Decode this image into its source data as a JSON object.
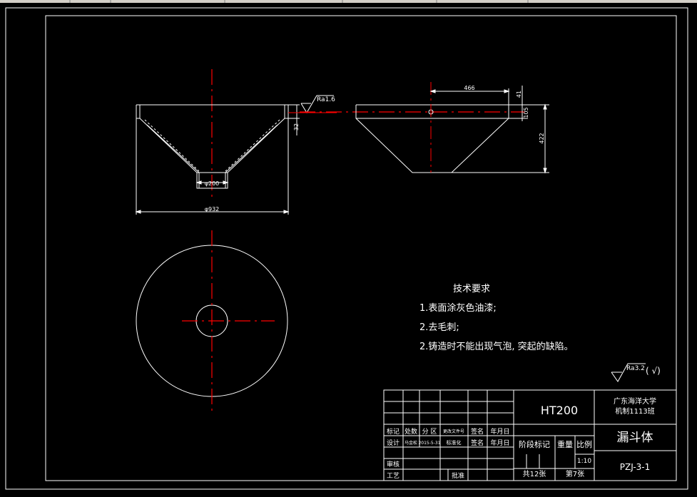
{
  "toolbar_strip": {
    "color": "#d4d0c8"
  },
  "colors": {
    "background": "#000000",
    "line": "#ffffff",
    "center_line": "#ff0000"
  },
  "front_view": {
    "roughness_label": "Ra1.6",
    "dim_bottom_dia": "φ200",
    "dim_top_dia": "φ932",
    "dim_rim": "32"
  },
  "side_view": {
    "dim_width": "466",
    "dim_top": "41",
    "dim_step": "105",
    "dim_height": "422"
  },
  "tech_req": {
    "title": "技术要求",
    "items": [
      "1.表面涂灰色油漆;",
      "2.去毛刺;",
      "2.铸造时不能出现气泡, 突起的缺陷。"
    ]
  },
  "surface_mark": {
    "label": "Ra3.2",
    "suffix": "( √)"
  },
  "title_block": {
    "material": "HT200",
    "school_line1": "广东海洋大学",
    "school_line2": "机制1113班",
    "part_name": "漏斗体",
    "drawing_no": "PZJ-3-1",
    "row_marks": [
      "标记",
      "处数",
      "分 区",
      "更改文件号",
      "签名",
      "年月日"
    ],
    "row_design": [
      "设计",
      "马金松",
      "2015-5-31",
      "标准化",
      "签名",
      "年月日"
    ],
    "stage_mark": "阶段标记",
    "weight": "重量",
    "scale_label": "比例",
    "scale_value": "1:10",
    "review": "审核",
    "process": "工艺",
    "approve": "批准",
    "total_sheets": "共12张",
    "sheet_no": "第7张"
  }
}
